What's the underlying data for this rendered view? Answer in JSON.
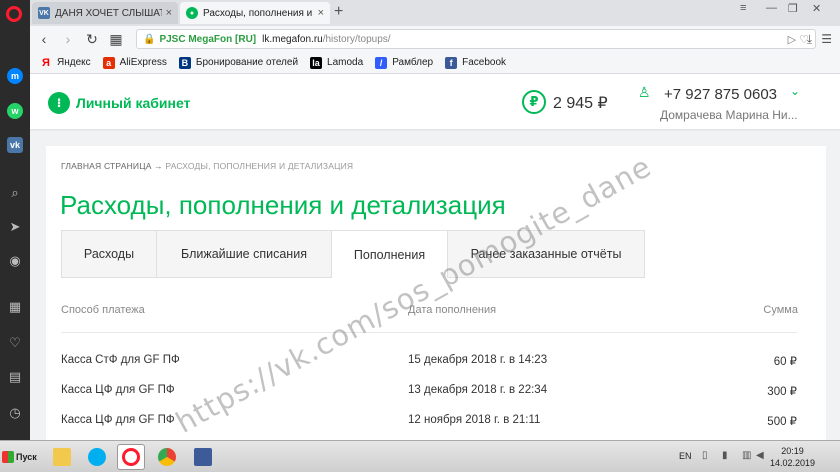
{
  "browser": {
    "tabs": [
      {
        "favicon": "vk-icon",
        "title": "ДАНЯ ХОЧЕТ СЛЫШАТЬ ДВ",
        "active": false
      },
      {
        "favicon": "megafon-icon",
        "title": "Расходы, пополнения и дет",
        "active": true
      }
    ],
    "address": {
      "org": "PJSC MegaFon [RU]",
      "host": "lk.megafon.ru",
      "path": "/history/topups/"
    },
    "bookmarks": [
      {
        "label": "Яндекс",
        "icon": "yandex-icon",
        "color": "#ff0000"
      },
      {
        "label": "AliExpress",
        "icon": "aliexpress-icon",
        "color": "#e62e04"
      },
      {
        "label": "Бронирование отелей",
        "icon": "booking-icon",
        "color": "#003580"
      },
      {
        "label": "Lamoda",
        "icon": "lamoda-icon",
        "color": "#000000"
      },
      {
        "label": "Рамблер",
        "icon": "rambler-icon",
        "color": "#315efb"
      },
      {
        "label": "Facebook",
        "icon": "facebook-icon",
        "color": "#3b5998"
      }
    ]
  },
  "header": {
    "cabinet_label": "Личный кабинет",
    "balance_symbol": "₽",
    "balance": "2 945 ₽",
    "phone": "+7 927 875 0603",
    "user_name": "Домрачева Марина Ни..."
  },
  "breadcrumb": {
    "home": "ГЛАВНАЯ СТРАНИЦА",
    "arrow": "→",
    "current": "РАСХОДЫ, ПОПОЛНЕНИЯ И ДЕТАЛИЗАЦИЯ"
  },
  "page_title": "Расходы, пополнения и детализация",
  "tabs": [
    {
      "label": "Расходы",
      "active": false
    },
    {
      "label": "Ближайшие списания",
      "active": false
    },
    {
      "label": "Пополнения",
      "active": true
    },
    {
      "label": "Ранее заказанные отчёты",
      "active": false
    }
  ],
  "table": {
    "columns": [
      "Способ платежа",
      "Дата пополнения",
      "Сумма"
    ],
    "rows": [
      {
        "method": "Касса СтФ для GF ПФ",
        "date": "15 декабря 2018 г. в 14:23",
        "amount": "60 ₽"
      },
      {
        "method": "Касса ЦФ для GF ПФ",
        "date": "13 декабря 2018 г. в 22:34",
        "amount": "300 ₽"
      },
      {
        "method": "Касса ЦФ для GF ПФ",
        "date": "12 ноября 2018 г. в 21:11",
        "amount": "500 ₽"
      }
    ]
  },
  "watermark": "https://vk.com/sos_pomogite_dane",
  "taskbar": {
    "start_label": "Пуск",
    "language": "EN",
    "time": "20:19",
    "date": "14.02.2019"
  },
  "colors": {
    "brand_green": "#00b956",
    "opera_red": "#ff1b2d",
    "vk_blue": "#4a76a8"
  }
}
